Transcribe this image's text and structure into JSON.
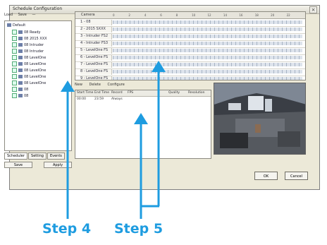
{
  "window": {
    "title": "Schedule Configuration",
    "close_glyph": "×"
  },
  "tree_toolbar": [
    "Load",
    "Save",
    "—"
  ],
  "tree": {
    "root": "Default",
    "nodes": [
      "08 Ready",
      "08 2015 XXX",
      "08 Intruder",
      "08 Intruder",
      "08 LevelOne",
      "08 LevelOne",
      "08 LevelOne",
      "08 LevelOne",
      "08 LevelOne",
      "08",
      "08"
    ]
  },
  "tree_tabs": [
    "Scheduler",
    "Setting",
    "Events"
  ],
  "tree_buttons": [
    "Save",
    "Apply"
  ],
  "grid": {
    "header_label": "Camera",
    "hour_ticks": [
      "0",
      "2",
      "4",
      "6",
      "8",
      "10",
      "12",
      "14",
      "16",
      "18",
      "20",
      "22"
    ],
    "rows": [
      "1 - 08",
      "2 - 2015 SXXX",
      "3 - Intruder FS2",
      "4 - Intruder FS3",
      "5 - LevelOne FS",
      "6 - LevelOne FS",
      "7 - LevelOne FS",
      "8 - LevelOne FS",
      "9 - LevelOne FS"
    ]
  },
  "record_toolbar": [
    "New",
    "Delete",
    "Configure"
  ],
  "record_list": {
    "headers": [
      "Start Time",
      "End Time",
      "Record",
      "FPS",
      "Quality",
      "Resolution"
    ],
    "row": [
      "00:00",
      "23:59",
      "Always",
      "",
      "",
      ""
    ]
  },
  "dialog_buttons": {
    "ok": "OK",
    "cancel": "Cancel"
  },
  "annotations": {
    "step4": "Step 4",
    "step5": "Step 5",
    "color": "#1e9ce0"
  }
}
